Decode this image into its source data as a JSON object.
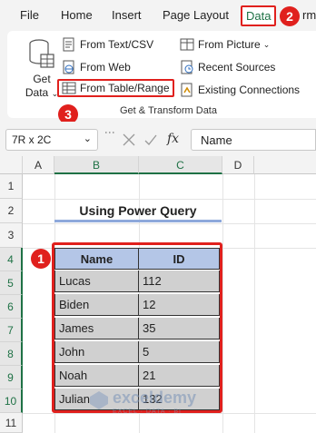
{
  "ribbon": {
    "tabs": [
      "File",
      "Home",
      "Insert",
      "Page Layout",
      "Data",
      "rm"
    ],
    "active_tab": "Data",
    "get_data": {
      "line1": "Get",
      "line2": "Data"
    },
    "commands": {
      "from_text_csv": "From Text/CSV",
      "from_web": "From Web",
      "from_table_range": "From Table/Range",
      "from_picture": "From Picture",
      "recent_sources": "Recent Sources",
      "existing_connections": "Existing Connections"
    },
    "group_label": "Get & Transform Data"
  },
  "annotations": {
    "step1": "1",
    "step2": "2",
    "step3": "3"
  },
  "formula_bar": {
    "name_box": "7R x 2C",
    "formula": "Name",
    "fx": "fx"
  },
  "grid": {
    "columns": [
      "A",
      "B",
      "C",
      "D"
    ],
    "rows": [
      "1",
      "2",
      "3",
      "4",
      "5",
      "6",
      "7",
      "8",
      "9",
      "10",
      "11"
    ],
    "title": "Using Power Query",
    "table": {
      "headers": [
        "Name",
        "ID"
      ],
      "rows": [
        [
          "Lucas",
          "112"
        ],
        [
          "Biden",
          "12"
        ],
        [
          "James",
          "35"
        ],
        [
          "John",
          "5"
        ],
        [
          "Noah",
          "21"
        ],
        [
          "Julian",
          "132"
        ]
      ]
    }
  },
  "watermark": {
    "name": "exceldemy",
    "tagline": "EXCEL · DATA · BI"
  },
  "colors": {
    "accent_red": "#e0201d",
    "excel_green": "#1e7145",
    "header_fill": "#b4c6e7",
    "cell_fill": "#d0d0d0"
  }
}
